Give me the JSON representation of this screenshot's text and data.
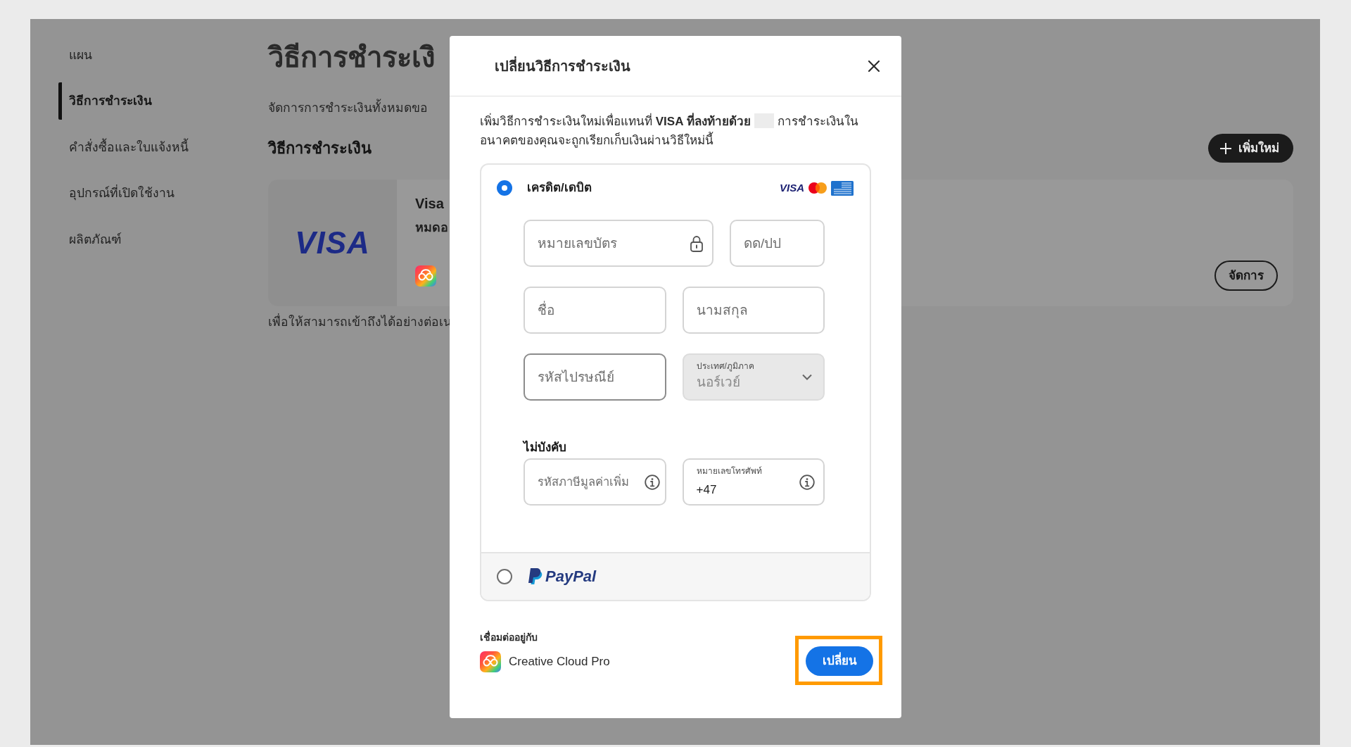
{
  "sidebar": {
    "items": [
      {
        "label": "แผน",
        "selected": false
      },
      {
        "label": "วิธีการชำระเงิน",
        "selected": true
      },
      {
        "label": "คำสั่งซื้อและใบแจ้งหนี้",
        "selected": false
      },
      {
        "label": "อุปกรณ์ที่เปิดใช้งาน",
        "selected": false
      },
      {
        "label": "ผลิตภัณฑ์",
        "selected": false
      }
    ]
  },
  "page": {
    "title": "วิธีการชำระเงิ",
    "subtitle": "จัดการการชำระเงินทั้งหมดขอ",
    "section_title": "วิธีการชำระเงิน",
    "add_button": "เพิ่มใหม่",
    "payment_card": {
      "logo": "VISA",
      "name": "Visa",
      "detail": "หมดอ",
      "manage_button": "จัดการ"
    },
    "note": "เพื่อให้สามารถเข้าถึงได้อย่างต่อเน"
  },
  "dialog": {
    "title": "เปลี่ยนวิธีการชำระเงิน",
    "intro_before": "เพิ่มวิธีการชำระเงินใหม่เพื่อแทนที่ **VISA ที่ลงท้ายด้วย**",
    "intro_after": "การชำระเงินในอนาคตของคุณจะถูกเรียกเก็บเงินผ่านวิธีใหม่นี้",
    "payment_options": [
      {
        "kind": "card",
        "label": "เครดิต/เดบิต",
        "selected": true,
        "card_brands": [
          {
            "kind": "visa",
            "label": "VISA"
          },
          {
            "kind": "mastercard"
          },
          {
            "kind": "amex"
          }
        ],
        "field_rows": [
          [
            {
              "kind": "secure_input",
              "placeholder": "หมายเลขบัตร",
              "focused": false
            },
            {
              "kind": "input",
              "placeholder": "ดด/ปป",
              "focused": false
            }
          ],
          [
            {
              "kind": "input",
              "placeholder": "ชื่อ",
              "focused": false
            },
            {
              "kind": "input",
              "placeholder": "นามสกุล",
              "focused": false
            }
          ],
          [
            {
              "kind": "input",
              "placeholder": "รหัสไปรษณีย์",
              "focused": true
            },
            {
              "kind": "select",
              "label": "ประเทศ/ภูมิภาค",
              "value": "นอร์เวย์",
              "disabled": true
            }
          ]
        ],
        "optional_label": "ไม่บังคับ",
        "optional_fields": [
          {
            "kind": "info_input",
            "placeholder": "รหัสภาษีมูลค่าเพิ่ม",
            "focused": false
          },
          {
            "kind": "phone",
            "label": "หมายเลขโทรศัพท์",
            "value": "+47",
            "focused": false
          }
        ]
      },
      {
        "kind": "paypal",
        "label": "PayPal",
        "selected": false
      }
    ],
    "footer": {
      "linked_label": "เชื่อมต่ออยู่กับ",
      "linked_product": "Creative Cloud Pro",
      "submit": {
        "label": "เปลี่ยน",
        "highlighted": true
      }
    }
  }
}
